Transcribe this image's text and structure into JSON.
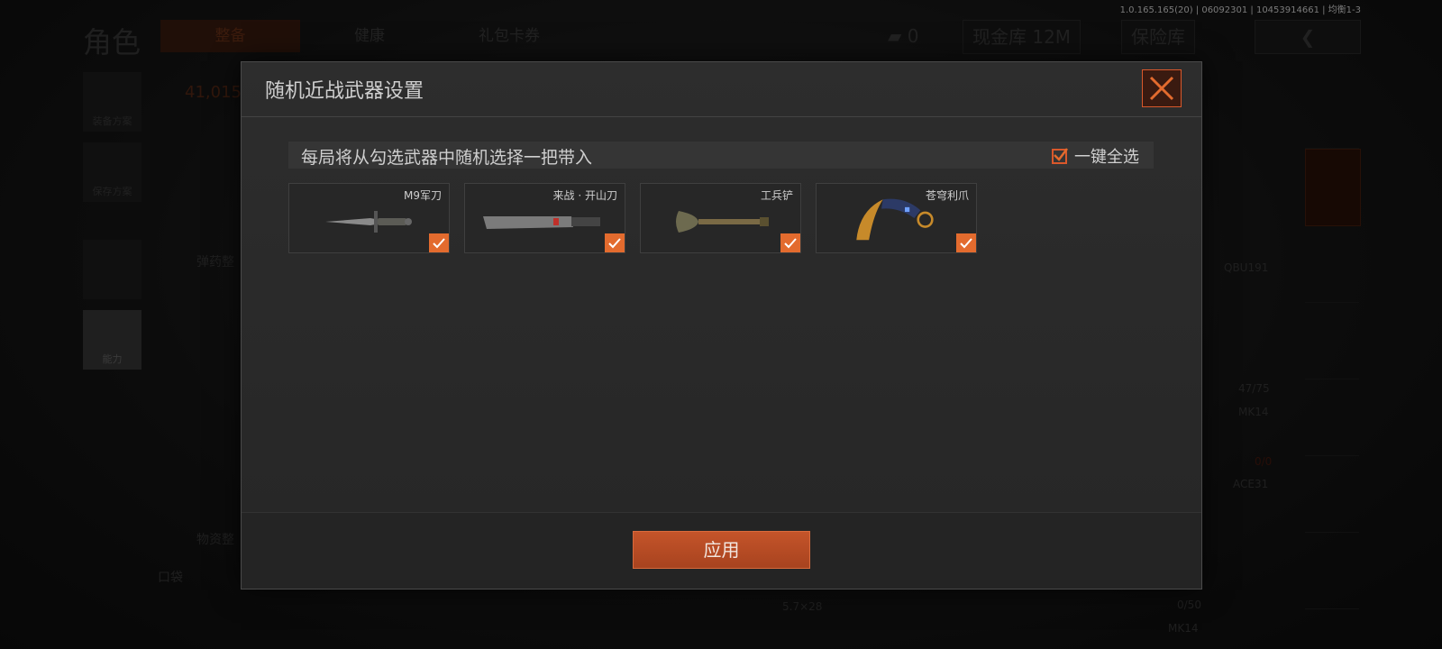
{
  "version": "1.0.165.165(20) | 06092301 | 10453914661 | 均衡1-3",
  "top": {
    "role_title": "角色",
    "tabs": [
      "整备",
      "健康",
      "礼包卡券"
    ],
    "money_count": "0",
    "cash_vault": "现金库 12M",
    "safe_vault": "保险库"
  },
  "left_sidebar": [
    "装备方案",
    "保存方案",
    "",
    "能力"
  ],
  "background_labels": {
    "value": "41,015",
    "ammo": "弹药整",
    "supplies": "物资整",
    "pocket": "口袋",
    "qbu": "QBU191",
    "ammo_count": "47/75",
    "mk14_a": "MK14",
    "zero": "0/0",
    "ace": "ACE31",
    "caliber": "5.7×28",
    "ammo2": "0/50",
    "mk14_b": "MK14"
  },
  "modal": {
    "title": "随机近战武器设置",
    "info": "每局将从勾选武器中随机选择一把带入",
    "select_all_label": "一键全选",
    "select_all_checked": true,
    "weapons": [
      {
        "name": "M9军刀",
        "checked": true
      },
      {
        "name": "来战 · 开山刀",
        "checked": true
      },
      {
        "name": "工兵铲",
        "checked": true
      },
      {
        "name": "苍穹利爪",
        "checked": true
      }
    ],
    "apply_label": "应用"
  },
  "colors": {
    "accent": "#e36b2e",
    "border_accent": "#d9582b"
  }
}
